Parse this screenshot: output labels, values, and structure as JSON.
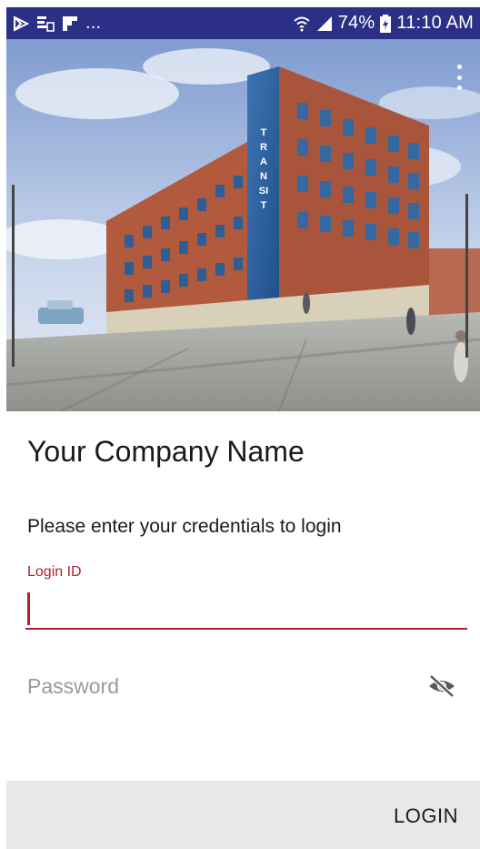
{
  "status_bar": {
    "left_icons": [
      "play-store-icon",
      "notification-icon",
      "flipboard-icon"
    ],
    "overflow_text": "...",
    "battery_percent": "74%",
    "time": "11:10 AM",
    "background_color": "#2c2f86"
  },
  "hero": {
    "image_subject": "building illustration",
    "building_sign": "TRANSIT",
    "overflow_menu_icon": "more-vert-icon"
  },
  "form": {
    "company_name": "Your Company Name",
    "instructions": "Please enter your credentials to login",
    "login_id_label": "Login ID",
    "login_id_value": "",
    "password_placeholder": "Password",
    "visibility_icon": "eye-off-icon",
    "accent_color": "#b0202f"
  },
  "footer": {
    "login_label": "LOGIN",
    "background_color": "#e6e8ea"
  }
}
